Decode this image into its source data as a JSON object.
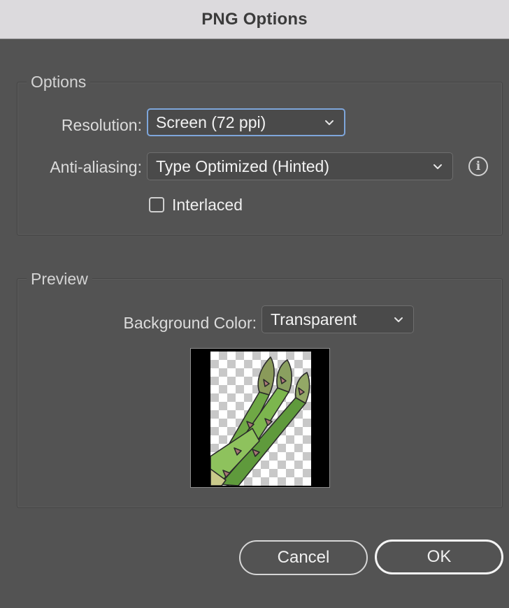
{
  "window": {
    "title": "PNG Options"
  },
  "options_group": {
    "label": "Options",
    "resolution": {
      "label": "Resolution:",
      "value": "Screen (72 ppi)"
    },
    "antialiasing": {
      "label": "Anti-aliasing:",
      "value": "Type Optimized (Hinted)"
    },
    "interlaced": {
      "label": "Interlaced",
      "checked": false
    }
  },
  "preview_group": {
    "label": "Preview",
    "background_color": {
      "label": "Background Color:",
      "value": "Transparent"
    }
  },
  "buttons": {
    "cancel": "Cancel",
    "ok": "OK"
  },
  "colors": {
    "dialog_bg": "#535353",
    "focus_ring": "#7ea6db",
    "titlebar": "#dcdadd"
  }
}
